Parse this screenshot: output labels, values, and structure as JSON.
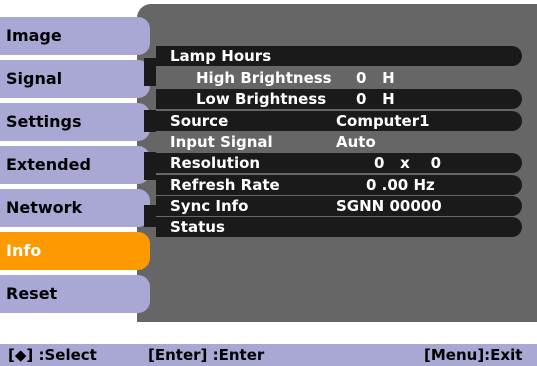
{
  "menu": {
    "items": [
      {
        "label": "Image",
        "active": false
      },
      {
        "label": "Signal",
        "active": false
      },
      {
        "label": "Settings",
        "active": false
      },
      {
        "label": "Extended",
        "active": false
      },
      {
        "label": "Network",
        "active": false
      },
      {
        "label": "Info",
        "active": true
      },
      {
        "label": "Reset",
        "active": false
      }
    ]
  },
  "info": {
    "lamp_hours_label": "Lamp Hours",
    "high_brightness_label": "High Brightness",
    "high_brightness_value": "0   H",
    "low_brightness_label": "Low Brightness",
    "low_brightness_value": "0   H",
    "source_label": "Source",
    "source_value": "Computer1",
    "input_signal_label": "Input Signal",
    "input_signal_value": "Auto",
    "resolution_label": "Resolution",
    "resolution_value": "0   x    0",
    "refresh_rate_label": "Refresh Rate",
    "refresh_rate_value": "0 .00 Hz",
    "sync_info_label": "Sync Info",
    "sync_info_value": "SGNN 00000",
    "status_label": "Status"
  },
  "footer": {
    "select_hint": "[◆] :Select",
    "enter_hint": "[Enter] :Enter",
    "exit_hint": "[Menu]:Exit"
  },
  "colors": {
    "menu_item": "#a9a8d4",
    "menu_active": "#ff9900",
    "panel": "#666666",
    "row": "#1a1a1a"
  }
}
